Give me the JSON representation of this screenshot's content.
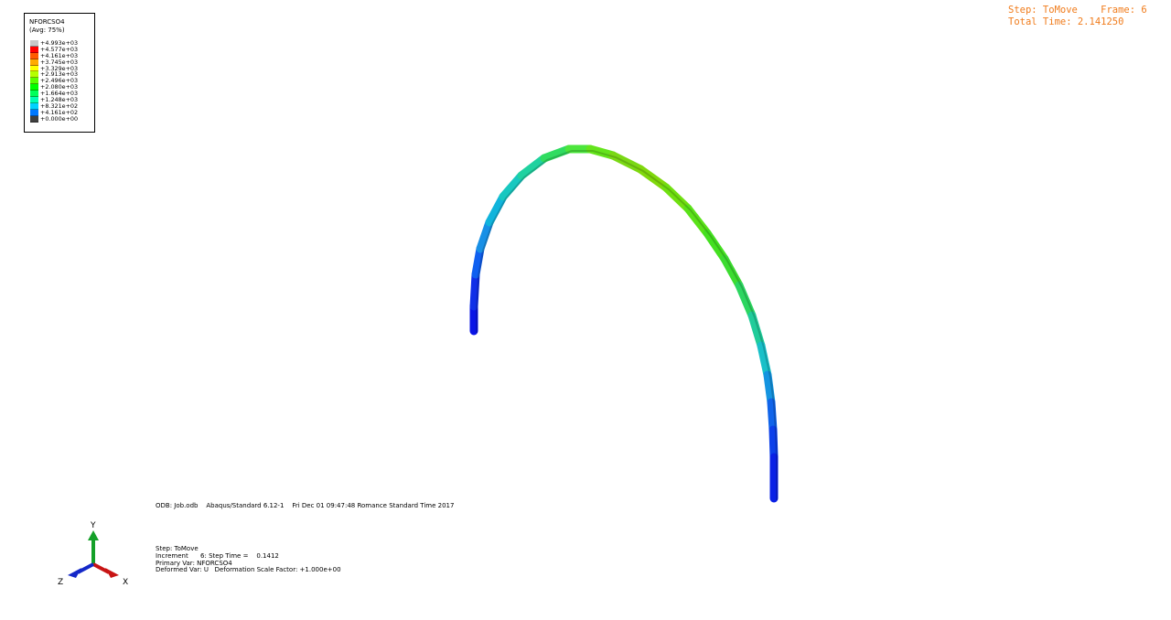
{
  "legend": {
    "title": "NFORCSO4",
    "averaging": "(Avg: 75%)",
    "entries": [
      {
        "label": "+4.993e+03",
        "color": "#c8c8c8"
      },
      {
        "label": "+4.577e+03",
        "color": "#ff0000"
      },
      {
        "label": "+4.161e+03",
        "color": "#ff5a00"
      },
      {
        "label": "+3.745e+03",
        "color": "#ffaa00"
      },
      {
        "label": "+3.329e+03",
        "color": "#ffff00"
      },
      {
        "label": "+2.913e+03",
        "color": "#b4ff00"
      },
      {
        "label": "+2.496e+03",
        "color": "#5aff00"
      },
      {
        "label": "+2.080e+03",
        "color": "#00ff00"
      },
      {
        "label": "+1.664e+03",
        "color": "#00ff5a"
      },
      {
        "label": "+1.248e+03",
        "color": "#00ffb4"
      },
      {
        "label": "+8.321e+02",
        "color": "#00d2ff"
      },
      {
        "label": "+4.161e+02",
        "color": "#0078ff"
      },
      {
        "label": "+0.000e+00",
        "color": "#0000ff"
      }
    ],
    "below_color": "#404040"
  },
  "step_info": {
    "line1": "Step: ToMove    Frame: 6",
    "line2": "Total Time: 2.141250"
  },
  "title_block": {
    "odb_line": "ODB: Job.odb    Abaqus/Standard 6.12-1    Fri Dec 01 09:47:48 Romance Standard Time 2017"
  },
  "info_block": {
    "step": "Step: ToMove",
    "increment": "Increment      6: Step Time =    0.1412",
    "primary_var": "Primary Var: NFORCSO4",
    "deformed_var": "Deformed Var: U   Deformation Scale Factor: +1.000e+00"
  },
  "triad": {
    "y_label": "Y",
    "x_label": "X",
    "z_label": "Z",
    "x_color": "#c81414",
    "y_color": "#14a028",
    "z_color": "#1428c8"
  }
}
